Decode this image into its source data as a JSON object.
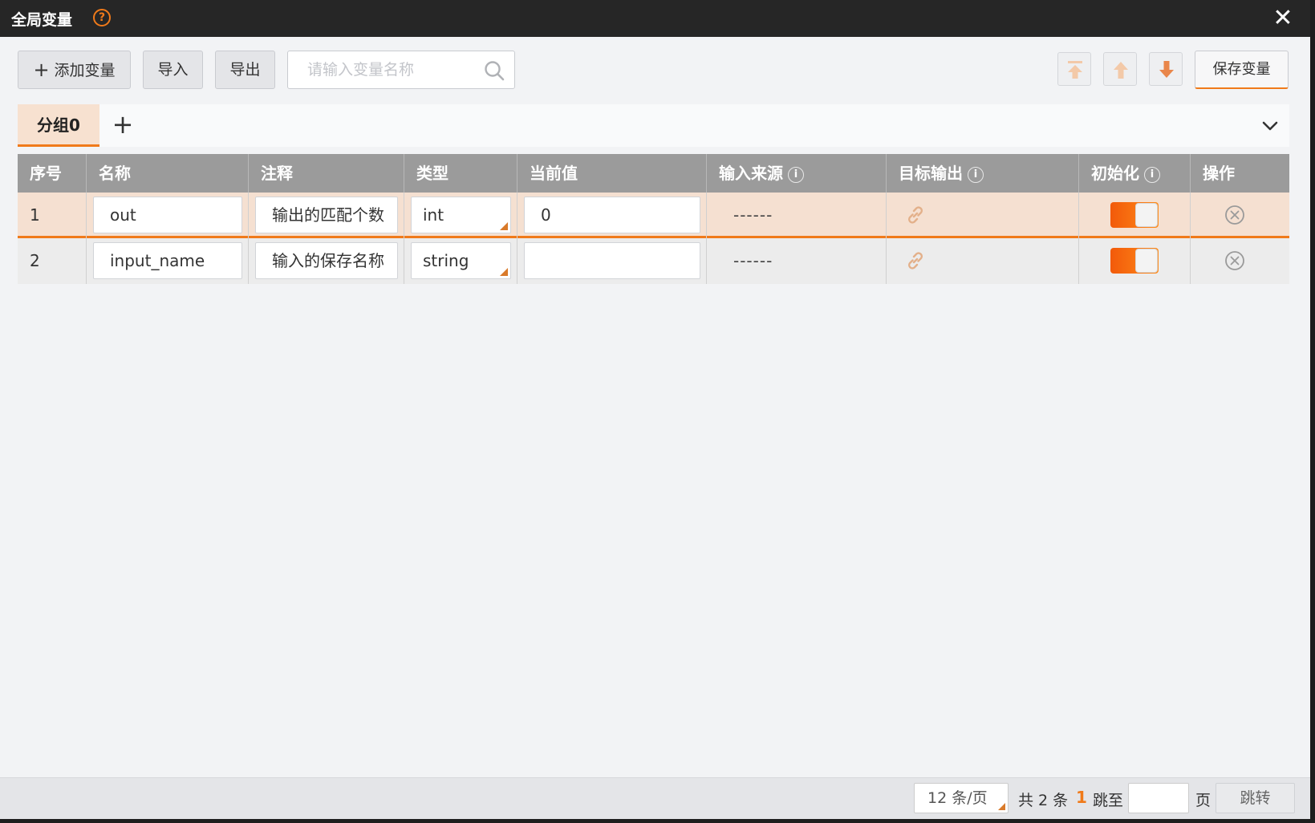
{
  "window": {
    "title": "全局变量",
    "help_glyph": "?",
    "close_glyph": "✕"
  },
  "toolbar": {
    "add_plus": "+",
    "add_label": "添加变量",
    "import_label": "导入",
    "export_label": "导出",
    "search_placeholder": "请输入变量名称",
    "search_value": "",
    "save_label": "保存变量"
  },
  "tabs": {
    "items": [
      {
        "label": "分组0",
        "active": true
      }
    ],
    "add_glyph": "+"
  },
  "table": {
    "columns": [
      "序号",
      "名称",
      "注释",
      "类型",
      "当前值",
      "输入来源",
      "目标输出",
      "初始化",
      "操作"
    ],
    "info_glyph": "i",
    "rows": [
      {
        "index": "1",
        "name": "out",
        "comment": "输出的匹配个数",
        "type": "int",
        "value": "0",
        "source": "------",
        "init": true,
        "selected": true
      },
      {
        "index": "2",
        "name": "input_name",
        "comment": "输入的保存名称",
        "type": "string",
        "value": "",
        "source": "------",
        "init": true,
        "selected": false
      }
    ]
  },
  "pagination": {
    "page_size": "12 条/页",
    "total": "共 2 条",
    "current_page": "1",
    "jump_label": "跳至",
    "page_unit": "页",
    "jump_button": "跳转"
  },
  "colors": {
    "accent": "#f07a1a",
    "titlebar": "#262626",
    "header": "#9b9b9b",
    "selected_row": "#f5e0d1"
  }
}
